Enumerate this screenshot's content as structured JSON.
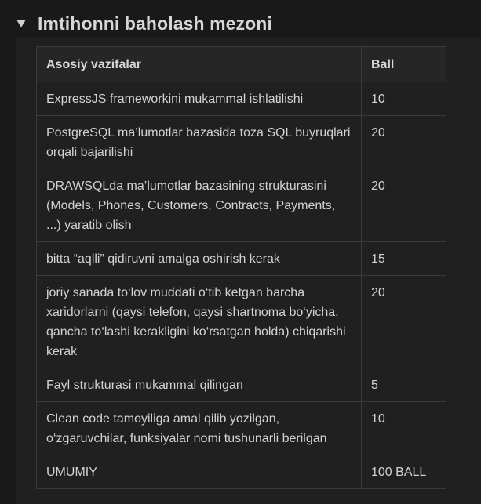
{
  "toggle": {
    "heading": "Imtihonni baholash mezoni",
    "icon": "triangle-down-icon",
    "expanded": true
  },
  "table": {
    "headers": [
      "Asosiy vazifalar",
      "Ball"
    ],
    "rows": [
      {
        "task": "ExpressJS frameworkini mukammal ishlatilishi",
        "score": "10"
      },
      {
        "task": "PostgreSQL ma’lumotlar bazasida toza SQL buyruqlari orqali bajarilishi",
        "score": "20"
      },
      {
        "task": "DRAWSQLda ma’lumotlar bazasining strukturasini (Models, Phones, Customers, Contracts, Payments, ...) yaratib olish",
        "score": "20"
      },
      {
        "task": "bitta “aqlli” qidiruvni amalga oshirish kerak",
        "score": "15"
      },
      {
        "task": "joriy sanada to‘lov muddati o‘tib ketgan barcha xaridorlarni (qaysi telefon, qaysi shartnoma bo‘yicha, qancha to‘lashi kerakligini ko‘rsatgan holda) chiqarishi kerak",
        "score": "20"
      },
      {
        "task": "Fayl strukturasi mukammal qilingan",
        "score": "5"
      },
      {
        "task": "Clean code tamoyiliga amal qilib yozilgan, o‘zgaruvchilar, funksiyalar nomi tushunarli berilgan",
        "score": "10"
      },
      {
        "task": "UMUMIY",
        "score": "100 BALL"
      }
    ]
  }
}
